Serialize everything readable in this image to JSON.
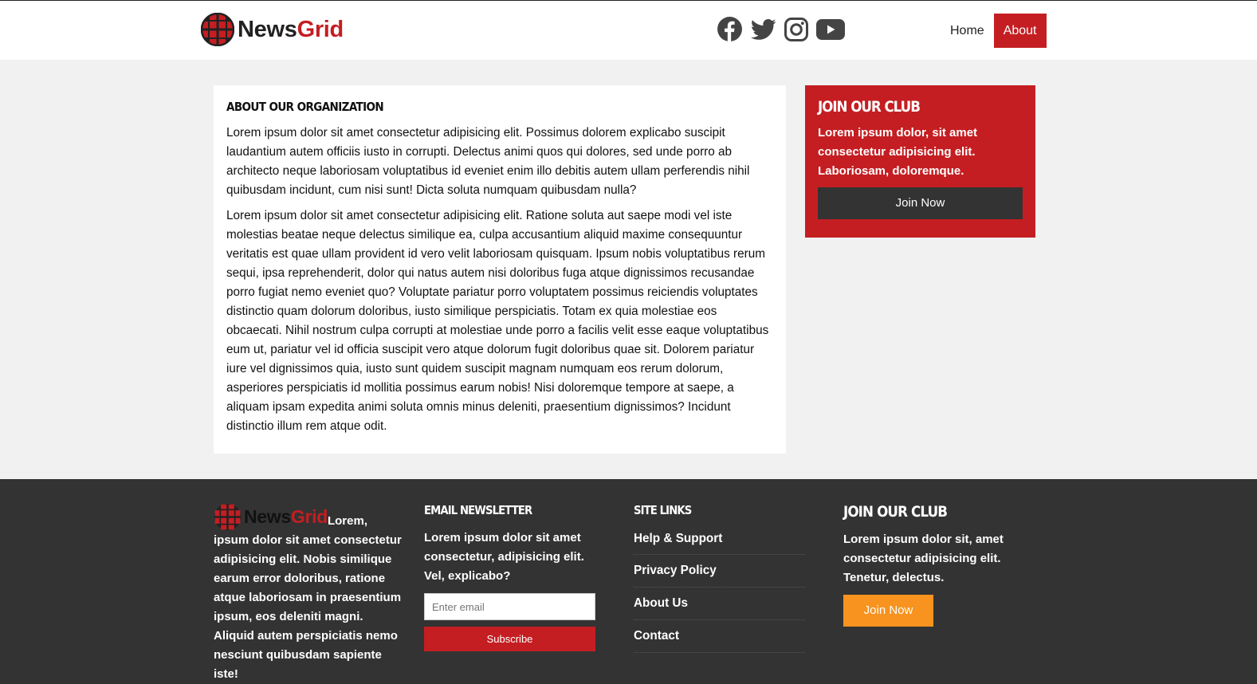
{
  "brand": {
    "name_part1": "News",
    "name_part2": "Grid"
  },
  "colors": {
    "accent": "#c41e22",
    "footer_bg": "#333333",
    "page_bg": "#f1f1f1",
    "orange": "#f7931e"
  },
  "header": {
    "social": [
      "facebook-icon",
      "twitter-icon",
      "instagram-icon",
      "youtube-icon"
    ],
    "nav": [
      {
        "label": "Home",
        "active": false
      },
      {
        "label": "About",
        "active": true
      }
    ]
  },
  "article": {
    "title": "About Our Organization",
    "paragraphs": [
      "Lorem ipsum dolor sit amet consectetur adipisicing elit. Possimus dolorem explicabo suscipit laudantium autem officiis iusto in corrupti. Delectus animi quos qui dolores, sed unde porro ab architecto neque laboriosam voluptatibus id eveniet enim illo debitis autem ullam perferendis nihil quibusdam incidunt, cum nisi sunt! Dicta soluta numquam quibusdam nulla?",
      "Lorem ipsum dolor sit amet consectetur adipisicing elit. Ratione soluta aut saepe modi vel iste molestias beatae neque delectus similique ea, culpa accusantium aliquid maxime consequuntur veritatis est quae ullam provident id vero velit laboriosam quisquam. Ipsum nobis voluptatibus rerum sequi, ipsa reprehenderit, dolor qui natus autem nisi doloribus fuga atque dignissimos recusandae porro fugiat nemo eveniet quo? Voluptate pariatur porro voluptatem possimus reiciendis voluptates distinctio quam dolorum doloribus, iusto similique perspiciatis. Totam ex quia molestiae eos obcaecati. Nihil nostrum culpa corrupti at molestiae unde porro a facilis velit esse eaque voluptatibus eum ut, pariatur vel id officia suscipit vero atque dolorum fugit doloribus quae sit. Dolorem pariatur iure vel dignissimos quia, iusto sunt quidem suscipit magnam numquam eos rerum dolorum, asperiores perspiciatis id mollitia possimus earum nobis! Nisi doloremque tempore at saepe, a aliquam ipsam expedita animi soluta omnis minus deleniti, praesentium dignissimos? Incidunt distinctio illum rem atque odit."
    ]
  },
  "sidebar_club": {
    "title": "Join Our Club",
    "text": "Lorem ipsum dolor, sit amet consectetur adipisicing elit. Laboriosam, doloremque.",
    "button": "Join Now"
  },
  "footer": {
    "about_text": "Lorem, ipsum dolor sit amet consectetur adipisicing elit. Nobis similique earum error doloribus, ratione atque laboriosam in praesentium ipsum, eos deleniti magni. Aliquid autem perspiciatis nemo nesciunt quibusdam sapiente iste!",
    "newsletter": {
      "title": "Email Newsletter",
      "text": "Lorem ipsum dolor sit amet consectetur, adipisicing elit. Vel, explicabo?",
      "placeholder": "Enter email",
      "button": "Subscribe"
    },
    "links": {
      "title": "Site Links",
      "items": [
        "Help & Support",
        "Privacy Policy",
        "About Us",
        "Contact"
      ]
    },
    "club": {
      "title": "Join Our Club",
      "text": "Lorem ipsum dolor sit, amet consectetur adipisicing elit. Tenetur, delectus.",
      "button": "Join Now"
    }
  }
}
